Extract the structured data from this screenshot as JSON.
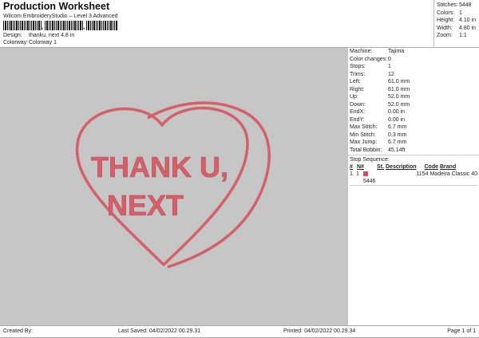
{
  "header": {
    "title": "Production Worksheet",
    "subtitle": "Wilcom EmbroideryStudio – Level 3 Advanced",
    "barcode_sep": ",",
    "design_label": "Design:",
    "design_value": "thanku, next 4,8 in",
    "colorway_label": "Colorway:",
    "colorway_value": "Colorway 1"
  },
  "summary": [
    {
      "k": "Stitches:",
      "v": "5448"
    },
    {
      "k": "Colors:",
      "v": "1"
    },
    {
      "k": "Height:",
      "v": "4.10 in"
    },
    {
      "k": "Width:",
      "v": "4.80 in"
    },
    {
      "k": "Zoom:",
      "v": "1:1"
    }
  ],
  "specs": [
    {
      "k": "Machine:",
      "v": "Tajima"
    },
    {
      "k": "Color changes:",
      "v": "0"
    },
    {
      "k": "Stops:",
      "v": "1"
    },
    {
      "k": "Trims:",
      "v": "12"
    },
    {
      "k": "Left:",
      "v": "61.0 mm"
    },
    {
      "k": "Right:",
      "v": "61.0 mm"
    },
    {
      "k": "Up:",
      "v": "52.0 mm"
    },
    {
      "k": "Down:",
      "v": "52.0 mm"
    },
    {
      "k": "EndX:",
      "v": "0.00 in"
    },
    {
      "k": "EndY:",
      "v": "0.00 in"
    },
    {
      "k": "Max Stitch:",
      "v": "6.7 mm"
    },
    {
      "k": "Min Stitch:",
      "v": "0.3 mm"
    },
    {
      "k": "Max Jump:",
      "v": "6.7 mm"
    },
    {
      "k": "Total Bobbin:",
      "v": "45.14ft"
    }
  ],
  "stop_sequence": {
    "title": "Stop Sequence:",
    "headers": [
      "#",
      "N#",
      "St.",
      "Description",
      "Code",
      "Brand"
    ],
    "rows": [
      {
        "n": "1.",
        "nn": "1",
        "color": "#e0475e",
        "st": "5446",
        "desc": "",
        "code": "1154",
        "brand": "Madeira Classic 40"
      }
    ]
  },
  "design": {
    "line1": "THANK U,",
    "line2": "NEXT",
    "thread_color": "#d4606a",
    "background": "#c6c6c6"
  },
  "footer": {
    "created": "Created By:",
    "saved": "Last Saved: 04/02/2022 00.29.31",
    "printed": "Printed: 04/02/2022 00.29.34",
    "page": "Page 1 of 1"
  }
}
